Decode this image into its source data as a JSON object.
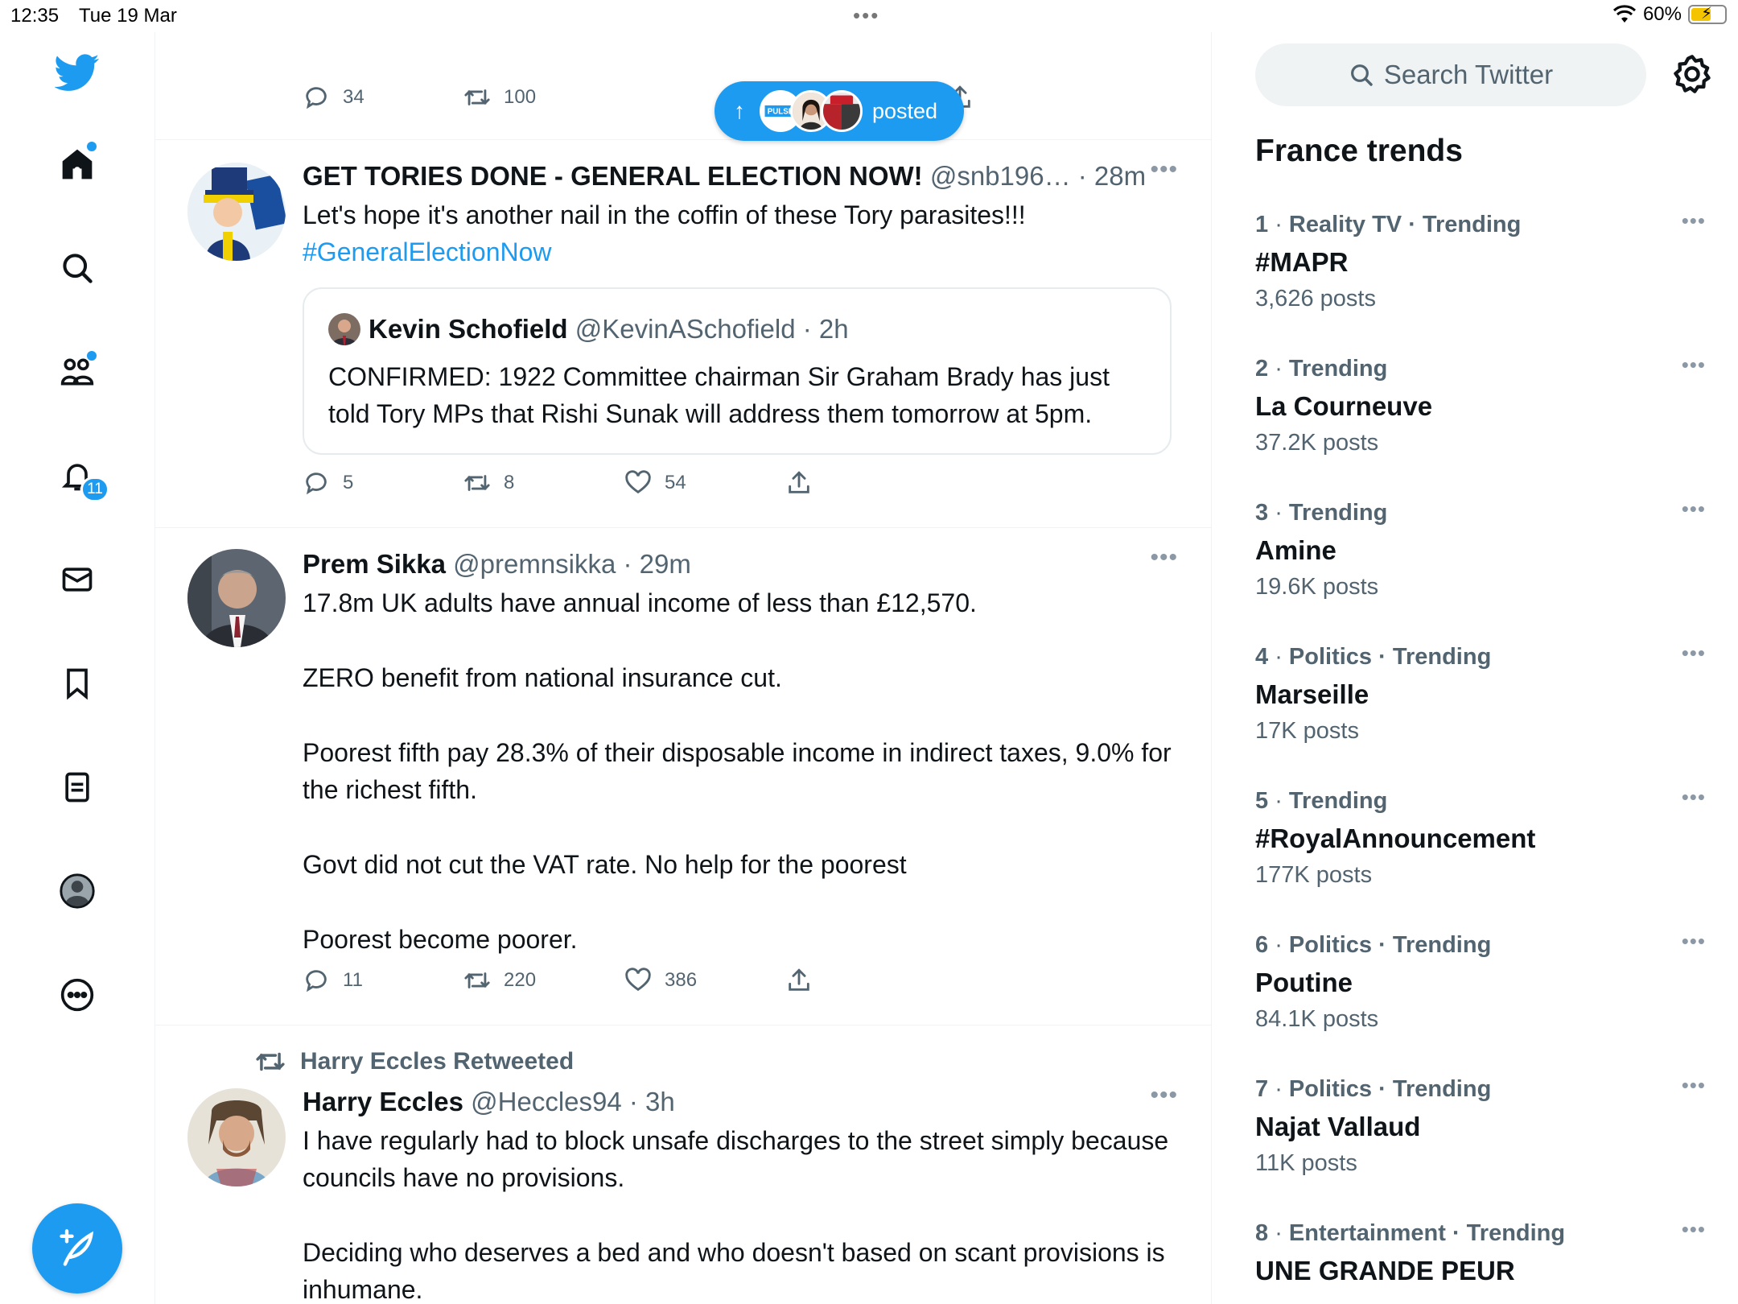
{
  "status_bar": {
    "time": "12:35",
    "date": "Tue 19 Mar",
    "battery": "60%",
    "battery_level": 0.6
  },
  "nav": {
    "notifications_badge": "11",
    "items": [
      "home-icon",
      "search-icon",
      "communities-icon",
      "notifications-icon",
      "messages-icon",
      "bookmarks-icon",
      "lists-icon",
      "profile-icon",
      "more-icon"
    ]
  },
  "new_posts_pill": {
    "arrow": "↑",
    "label": "posted"
  },
  "tweets": [
    {
      "actions": {
        "replies": "34",
        "retweets": "100"
      }
    },
    {
      "name": "GET TORIES DONE - GENERAL ELECTION NOW!",
      "meta": " @snb196… · 28m",
      "text": "Let's hope it's another nail in the coffin of these Tory parasites!!!",
      "hashtag": "#GeneralElectionNow",
      "quote": {
        "name": "Kevin Schofield",
        "meta": " @KevinASchofield · 2h",
        "text": "CONFIRMED: 1922 Committee chairman Sir Graham Brady has just told Tory MPs that Rishi Sunak will address them tomorrow at 5pm."
      },
      "actions": {
        "replies": "5",
        "retweets": "8",
        "likes": "54"
      }
    },
    {
      "name": "Prem Sikka",
      "meta": " @premnsikka · 29m",
      "paragraphs": [
        "17.8m UK adults have annual income of less than £12,570.",
        "ZERO benefit from national insurance cut.",
        "Poorest fifth pay 28.3% of their disposable income in indirect taxes, 9.0% for the richest fifth.",
        "Govt did not cut the VAT rate. No help for the poorest",
        "Poorest become poorer."
      ],
      "actions": {
        "replies": "11",
        "retweets": "220",
        "likes": "386"
      }
    },
    {
      "retweeted_by": "Harry Eccles Retweeted",
      "name": "Harry Eccles",
      "meta": " @Heccles94 · 3h",
      "paragraphs": [
        "I have regularly had to block unsafe discharges to the street simply because councils have no provisions.",
        "Deciding who deserves a bed and who doesn't based on scant provisions is inhumane."
      ]
    }
  ],
  "sidebar": {
    "search_placeholder": "Search Twitter",
    "title": "France trends",
    "trends": [
      {
        "rank": "1",
        "category": "Reality TV · Trending",
        "name": "#MAPR",
        "posts": "3,626 posts"
      },
      {
        "rank": "2",
        "category": "Trending",
        "name": "La Courneuve",
        "posts": "37.2K posts"
      },
      {
        "rank": "3",
        "category": "Trending",
        "name": "Amine",
        "posts": "19.6K posts"
      },
      {
        "rank": "4",
        "category": "Politics · Trending",
        "name": "Marseille",
        "posts": "17K posts"
      },
      {
        "rank": "5",
        "category": "Trending",
        "name": "#RoyalAnnouncement",
        "posts": "177K posts"
      },
      {
        "rank": "6",
        "category": "Politics · Trending",
        "name": "Poutine",
        "posts": "84.1K posts"
      },
      {
        "rank": "7",
        "category": "Politics · Trending",
        "name": "Najat Vallaud",
        "posts": "11K posts"
      },
      {
        "rank": "8",
        "category": "Entertainment · Trending",
        "name": "UNE GRANDE PEUR",
        "posts": ""
      }
    ]
  },
  "colors": {
    "accent": "#1d9bf0",
    "text": "#0f1419",
    "muted": "#536471"
  }
}
